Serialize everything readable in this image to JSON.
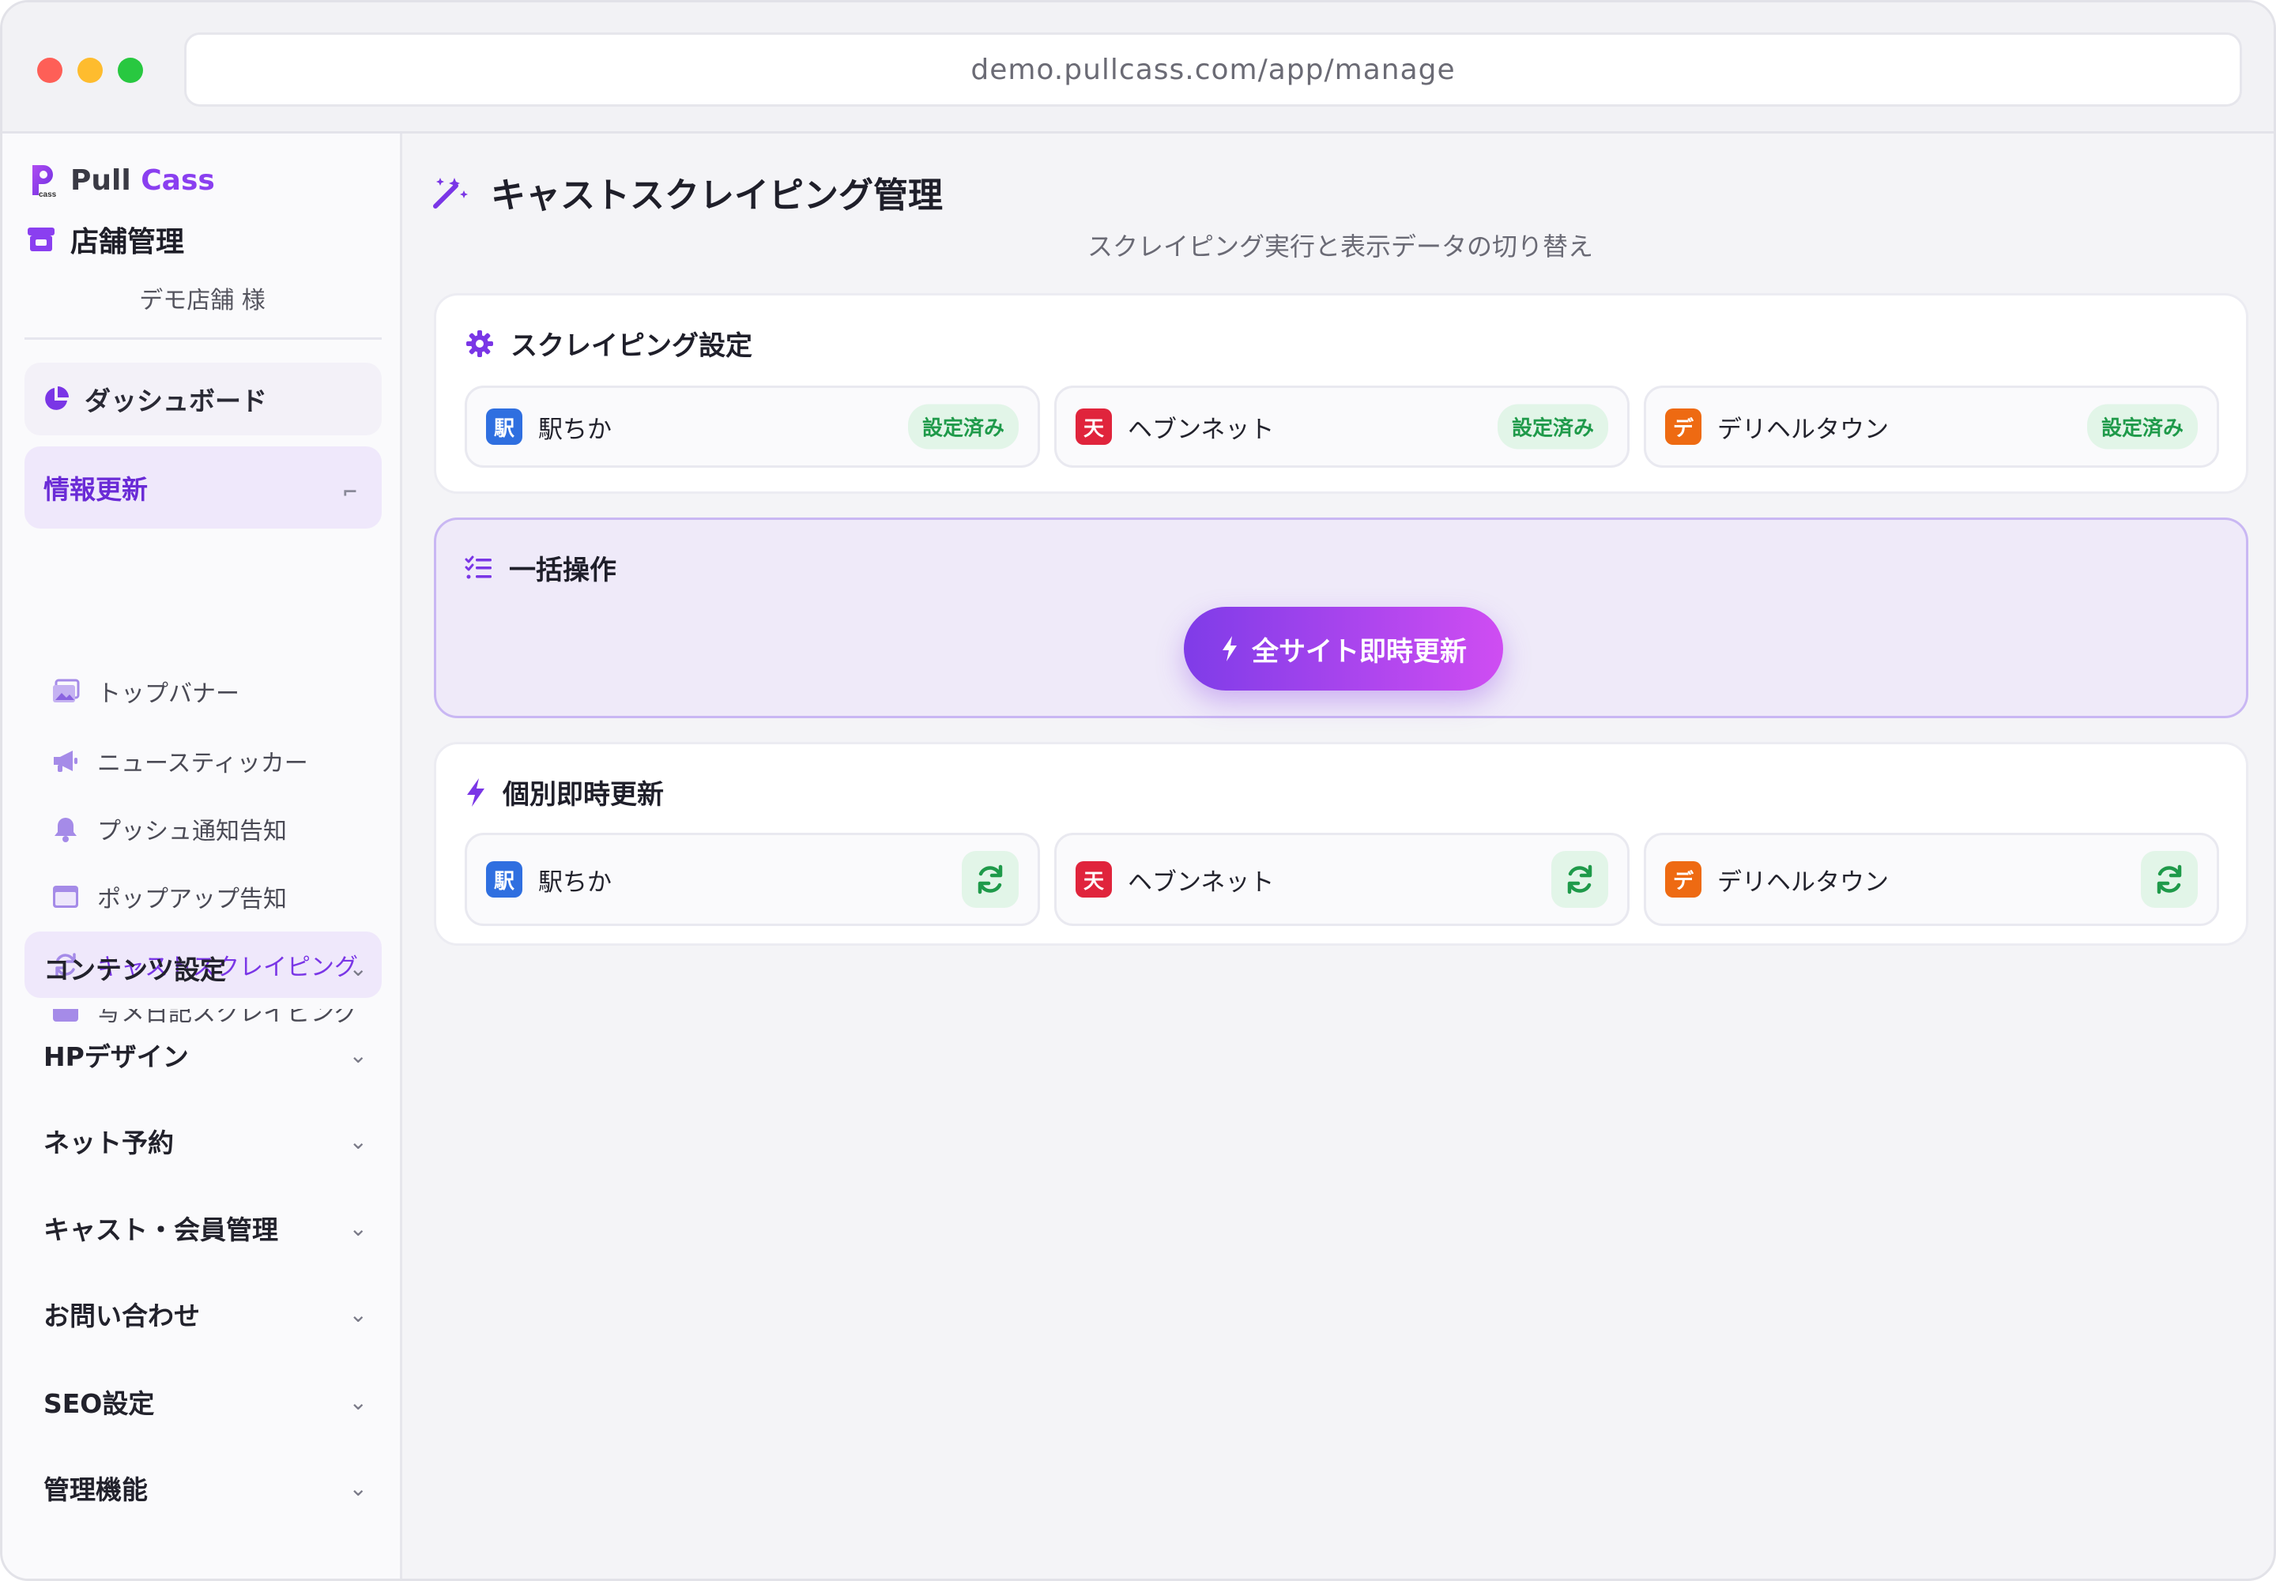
{
  "browser": {
    "url": "demo.pullcass.com/app/manage"
  },
  "brand": {
    "name_part1": "Pull",
    "name_part2": "Cass",
    "logo_small_text": "cass"
  },
  "store": {
    "title": "店舗管理",
    "user": "デモ店舗 様"
  },
  "sidebar": {
    "dashboard": "ダッシュボード",
    "info_update": "情報更新",
    "sub_items": [
      "トップバナー",
      "ニュースティッカー",
      "プッシュ通知告知",
      "ポップアップ告知",
      "キャストスクレイピング",
      "写メ日記スクレイピング"
    ],
    "groups": [
      "コンテンツ設定",
      "HPデザイン",
      "ネット予約",
      "キャスト・会員管理",
      "お問い合わせ",
      "SEO設定",
      "管理機能"
    ]
  },
  "page": {
    "title": "キャストスクレイピング管理",
    "subtitle": "スクレイピング実行と表示データの切り替え"
  },
  "settings_card": {
    "title": "スクレイピング設定",
    "sites": [
      {
        "badge": "駅",
        "name": "駅ちか",
        "status": "設定済み",
        "color": "#2f6fe0"
      },
      {
        "badge": "天",
        "name": "ヘブンネット",
        "status": "設定済み",
        "color": "#e0243c"
      },
      {
        "badge": "デ",
        "name": "デリヘルタウン",
        "status": "設定済み",
        "color": "#ee6a12"
      }
    ]
  },
  "bulk_card": {
    "title": "一括操作",
    "button": "全サイト即時更新"
  },
  "individual_card": {
    "title": "個別即時更新",
    "sites": [
      {
        "badge": "駅",
        "name": "駅ちか"
      },
      {
        "badge": "天",
        "name": "ヘブンネット"
      },
      {
        "badge": "デ",
        "name": "デリヘルタウン"
      }
    ]
  },
  "colors": {
    "accent": "#7a36e6",
    "success_bg": "#e2f5e8",
    "success_text": "#1f9a4a"
  }
}
